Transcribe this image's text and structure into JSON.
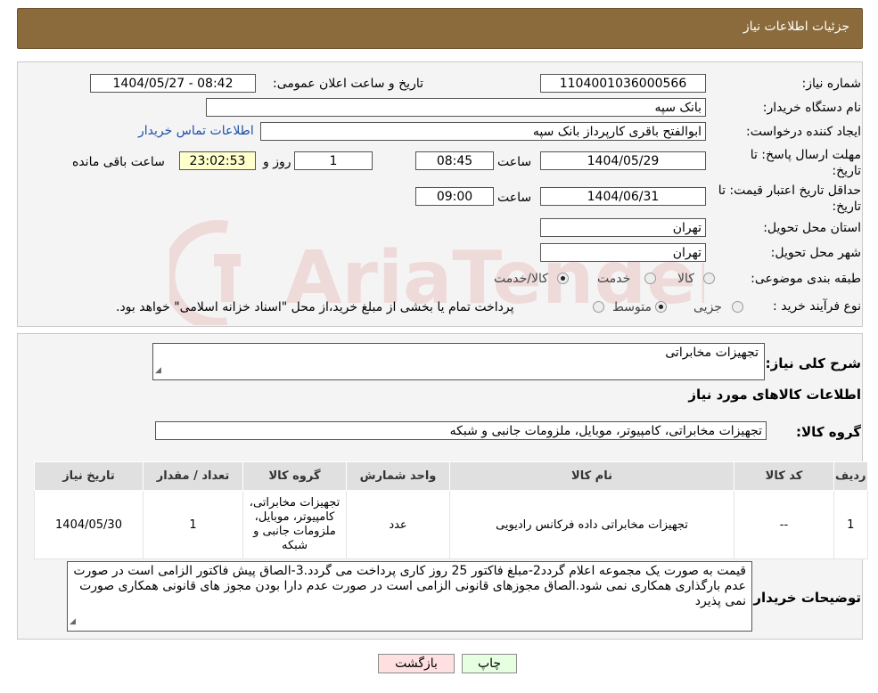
{
  "header": {
    "title": "جزئیات اطلاعات نیاز"
  },
  "form": {
    "need_number_label": "شماره نیاز:",
    "need_number": "1104001036000566",
    "announce_label": "تاریخ و ساعت اعلان عمومی:",
    "announce_value": "1404/05/27 - 08:42",
    "buyer_org_label": "نام دستگاه خریدار:",
    "buyer_org": "بانک سپه",
    "creator_label": "ایجاد کننده درخواست:",
    "creator": "ابوالفتح باقری کارپرداز بانک سپه",
    "contact_link": "اطلاعات تماس خریدار",
    "deadline_label_1": "مهلت ارسال پاسخ: تا",
    "deadline_label_2": "تاریخ:",
    "deadline_date": "1404/05/29",
    "time_label": "ساعت",
    "deadline_time": "08:45",
    "days_value": "1",
    "days_label": "روز و",
    "remaining_value": "23:02:53",
    "remaining_label": "ساعت باقی مانده",
    "validity_label_1": "حداقل تاریخ اعتبار قیمت: تا",
    "validity_label_2": "تاریخ:",
    "validity_date": "1404/06/31",
    "validity_time": "09:00",
    "province_label": "استان محل تحویل:",
    "province": "تهران",
    "city_label": "شهر محل تحویل:",
    "city": "تهران",
    "category_label": "طبقه بندی موضوعی:",
    "category_options": [
      "کالا",
      "خدمت",
      "کالا/خدمت"
    ],
    "process_label": "نوع فرآیند خرید :",
    "process_options": [
      "جزیی",
      "متوسط"
    ],
    "process_note": "پرداخت تمام یا بخشی از مبلغ خرید،از محل \"اسناد خزانه اسلامی\" خواهد بود."
  },
  "details": {
    "summary_label": "شرح کلی نیاز:",
    "summary": "تجهیزات مخابراتی",
    "goods_info_title": "اطلاعات کالاهای مورد نیاز",
    "group_label": "گروه کالا:",
    "group": "تجهیزات مخابراتی، کامپیوتر، موبایل، ملزومات جانبی و شبکه",
    "table_headers": [
      "ردیف",
      "کد کالا",
      "نام کالا",
      "واحد شمارش",
      "گروه کالا",
      "تعداد / مقدار",
      "تاریخ نیاز"
    ],
    "rows": [
      {
        "index": "1",
        "code": "--",
        "name": "تجهیزات مخابراتی داده فرکانس رادیویی",
        "unit": "عدد",
        "group": "تجهیزات مخابراتی، کامپیوتر، موبایل، ملزومات جانبی و شبکه",
        "qty": "1",
        "date": "1404/05/30"
      }
    ],
    "buyer_notes_label": "توضیحات خریدار:",
    "buyer_notes": "قیمت به صورت یک مجموعه اعلام گردد2-مبلغ فاکتور 25 روز کاری پرداخت می گردد.3-الصاق پیش فاکتور الزامی است در صورت عدم بارگذاری همکاری نمی شود.الصاق مجوزهای قانونی الزامی است در صورت عدم دارا بودن مجوز های قانونی همکاری صورت نمی پذیرد"
  },
  "buttons": {
    "print": "چاپ",
    "back": "بازگشت"
  },
  "watermark": {
    "text": "AriaTender.neT"
  },
  "colors": {
    "header": "#8b6b3c",
    "back_button": "#ffe0e0",
    "print_button": "#e6ffe0",
    "link": "#1f4fa8"
  }
}
